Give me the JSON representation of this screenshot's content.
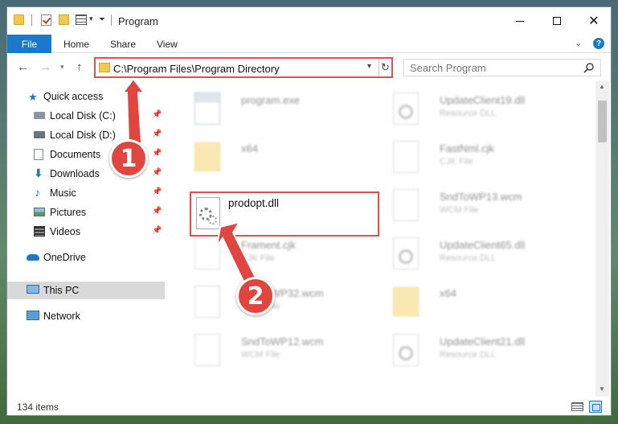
{
  "window": {
    "title": "Program"
  },
  "ribbon": {
    "file_tab": "File",
    "tabs": [
      "Home",
      "Share",
      "View"
    ]
  },
  "address": {
    "path": "C:\\Program Files\\Program Directory"
  },
  "search": {
    "placeholder": "Search Program"
  },
  "nav_pane": {
    "quick_access": "Quick access",
    "items": [
      {
        "label": "Local Disk (C:)",
        "icon": "drive-icon",
        "pinned": true
      },
      {
        "label": "Local Disk (D:)",
        "icon": "drive-icon",
        "pinned": true
      },
      {
        "label": "Documents",
        "icon": "documents-icon",
        "pinned": true
      },
      {
        "label": "Downloads",
        "icon": "download-icon",
        "pinned": true
      },
      {
        "label": "Music",
        "icon": "music-icon",
        "pinned": true
      },
      {
        "label": "Pictures",
        "icon": "pictures-icon",
        "pinned": true
      },
      {
        "label": "Videos",
        "icon": "videos-icon",
        "pinned": true
      }
    ],
    "onedrive": "OneDrive",
    "this_pc": "This PC",
    "network": "Network"
  },
  "files": {
    "left": [
      {
        "name": "program.exe",
        "type": "",
        "kind": "exe"
      },
      {
        "name": "x64",
        "type": "",
        "kind": "folder"
      },
      {
        "name": "prodopt.dll",
        "type": "",
        "kind": "dll",
        "highlighted": true
      },
      {
        "name": "Frament.cjk",
        "type": "CJK File",
        "kind": "doc"
      },
      {
        "name": "SndToWP32.wcm",
        "type": "WCM File",
        "kind": "doc"
      },
      {
        "name": "SndToWP12.wcm",
        "type": "WCM File",
        "kind": "doc"
      }
    ],
    "right": [
      {
        "name": "UpdateClient19.dll",
        "type": "Resource DLL",
        "kind": "dll"
      },
      {
        "name": "FastNml.cjk",
        "type": "CJK File",
        "kind": "doc"
      },
      {
        "name": "SndToWP13.wcm",
        "type": "WCM File",
        "kind": "doc"
      },
      {
        "name": "UpdateClient65.dll",
        "type": "Resource DLL",
        "kind": "dll"
      },
      {
        "name": "x64",
        "type": "",
        "kind": "folder"
      },
      {
        "name": "UpdateClient21.dll",
        "type": "Resource DLL",
        "kind": "dll"
      }
    ]
  },
  "status": {
    "item_count": "134 items"
  },
  "annotations": {
    "step1": "1",
    "step2": "2",
    "color": "#e0463d"
  },
  "colors": {
    "accent": "#1979ca",
    "highlight_border": "#d9534f"
  }
}
